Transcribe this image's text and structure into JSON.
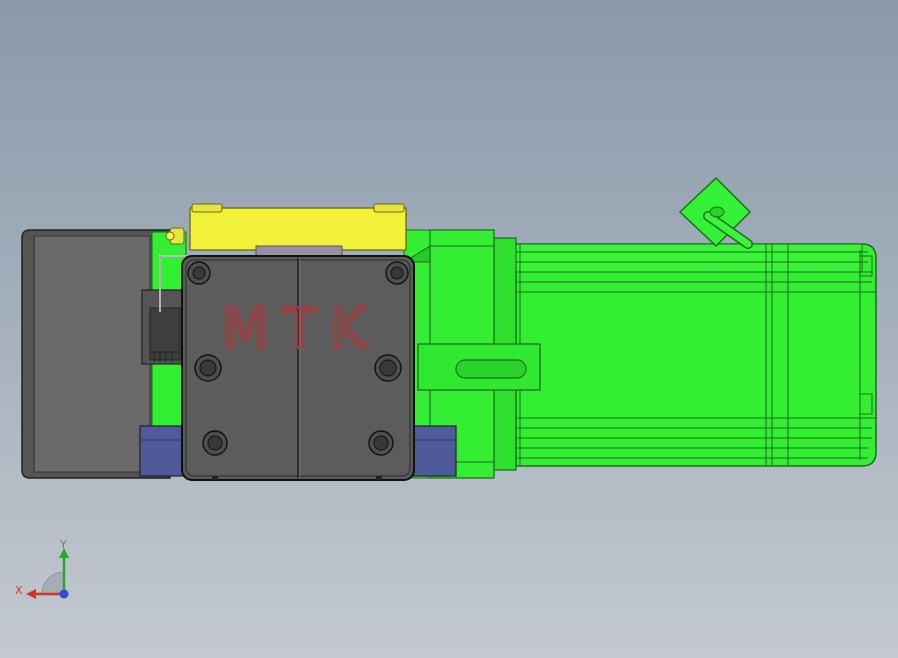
{
  "viewport": {
    "background_top": "#8a99aa",
    "background_bottom": "#c4c9d0"
  },
  "model": {
    "name_plate_text": "MTK",
    "colors": {
      "motor_body": "#33ee33",
      "motor_edge": "#1a6e1a",
      "gearbox_dark": "#5c5c5c",
      "housing_gray": "#6a6a6a",
      "top_bar": "#f2f23a",
      "base_blocks": "#4f5a9a",
      "logo": "#a33c3c"
    }
  },
  "triad": {
    "x_label": "X",
    "y_label": "Y",
    "x_color": "#d63030",
    "y_color": "#2aa82a",
    "z_color": "#2b4fd6"
  }
}
